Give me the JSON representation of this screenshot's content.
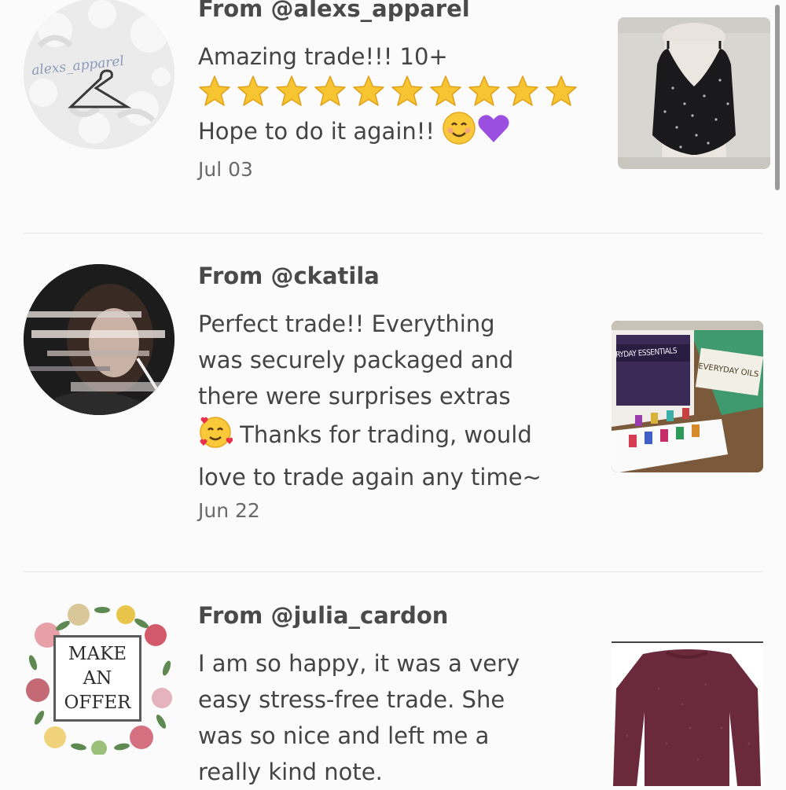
{
  "reviews": [
    {
      "avatar_text": "alexs_apparel",
      "from": "From @alexs_apparel",
      "lines": [
        "Amazing trade!!! 10+"
      ],
      "stars_count": 10,
      "after_stars": "Hope to do it again!! ",
      "date": "Jul 03"
    },
    {
      "from": "From @ckatila",
      "lines": [
        "Perfect trade!! Everything",
        "was securely packaged and",
        "there were surprises extras",
        " Thanks for trading, would",
        "love to trade again any time~"
      ],
      "date": "Jun 22",
      "thumb_left_label": "ERYDAY ESSENTIALS",
      "thumb_right_label": "EVERYDAY OILS"
    },
    {
      "avatar_lines": [
        "MAKE",
        "AN",
        "OFFER"
      ],
      "from": "From @julia_cardon",
      "lines": [
        "I am so happy, it was a very",
        "easy stress-free trade. She",
        "was so nice and left me a",
        "really kind note."
      ]
    }
  ],
  "colors": {
    "background": "#fbfbfb",
    "text": "#444444",
    "divider": "#e4e4e4",
    "star": "#f6c531",
    "heart": "#9b4fe0"
  },
  "icons": {
    "rating": "star-icon",
    "smile": "smiling-face-icon",
    "heart": "purple-heart-icon",
    "love": "smiling-face-with-hearts-icon"
  }
}
